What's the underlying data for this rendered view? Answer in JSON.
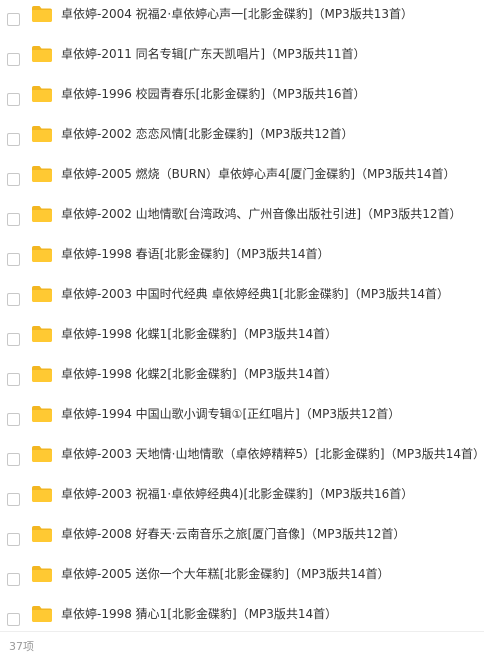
{
  "files": [
    {
      "name": "卓依婷-2004 祝福2·卓依婷心声一[北影金碟豹]（MP3版共13首）"
    },
    {
      "name": "卓依婷-2011 同名专辑[广东天凯唱片]（MP3版共11首）"
    },
    {
      "name": "卓依婷-1996 校园青春乐[北影金碟豹]（MP3版共16首）"
    },
    {
      "name": "卓依婷-2002 恋恋风情[北影金碟豹]（MP3版共12首）"
    },
    {
      "name": "卓依婷-2005 燃烧（BURN）卓依婷心声4[厦门金碟豹]（MP3版共14首）"
    },
    {
      "name": "卓依婷-2002 山地情歌[台湾政鸿、广州音像出版社引进]（MP3版共12首）"
    },
    {
      "name": "卓依婷-1998 春语[北影金碟豹]（MP3版共14首）"
    },
    {
      "name": "卓依婷-2003 中国时代经典 卓依婷经典1[北影金碟豹]（MP3版共14首）"
    },
    {
      "name": "卓依婷-1998 化蝶1[北影金碟豹]（MP3版共14首）"
    },
    {
      "name": "卓依婷-1998 化蝶2[北影金碟豹]（MP3版共14首）"
    },
    {
      "name": "卓依婷-1994 中国山歌小调专辑①[正红唱片]（MP3版共12首）"
    },
    {
      "name": "卓依婷-2003 天地情·山地情歌（卓依婷精粹5）[北影金碟豹]（MP3版共14首）"
    },
    {
      "name": "卓依婷-2003 祝福1·卓依婷经典4)[北影金碟豹]（MP3版共16首）"
    },
    {
      "name": "卓依婷-2008 好春天·云南音乐之旅[厦门音像]（MP3版共12首）"
    },
    {
      "name": "卓依婷-2005 送你一个大年糕[北影金碟豹]（MP3版共14首）"
    },
    {
      "name": "卓依婷-1998 猜心1[北影金碟豹]（MP3版共14首）"
    }
  ],
  "footer": {
    "count": "37项"
  },
  "icons": {
    "checkbox": "checkbox-icon",
    "folder": "folder-icon"
  },
  "colors": {
    "folder": "#FFC933",
    "folder_back": "#F2B621",
    "text": "#333333",
    "muted": "#999999"
  }
}
